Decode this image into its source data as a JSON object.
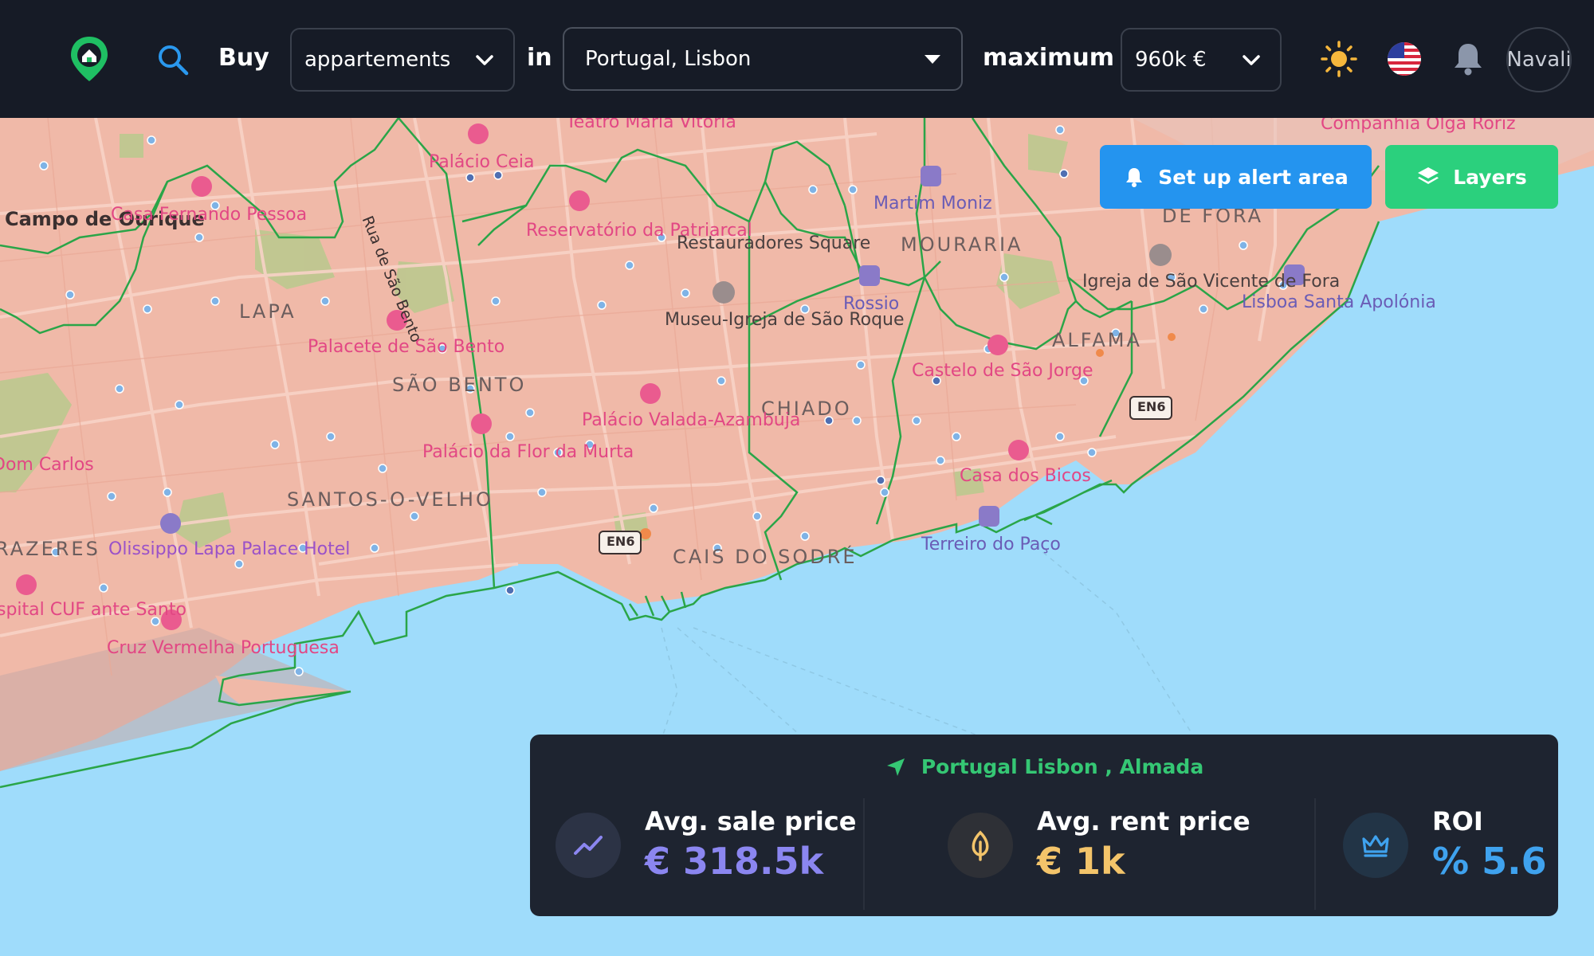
{
  "header": {
    "mode_label": "Buy",
    "property_type": "appartements",
    "in_label": "in",
    "location": "Portugal, Lisbon",
    "max_label": "maximum",
    "max_price": "960k €",
    "user_name": "Navali"
  },
  "map_controls": {
    "alert_button": "Set up alert area",
    "layers_button": "Layers"
  },
  "map_labels": {
    "teatro": "Teatro Maria Vitória",
    "companhia": "Companhia Olga Roriz",
    "campo": "Campo de Ourique",
    "casa_pessoa": "Casa Fernando Pessoa",
    "palacio_ceia": "Palácio Ceia",
    "rua": "Rua de São Bento",
    "reservatorio": "Reservatório da Patriarcal",
    "restauradores": "Restauradores Square",
    "martim": "Martim Moniz",
    "mouraria": "MOURARIA",
    "de_fora": "DE FORA",
    "lapa": "LAPA",
    "palacete": "Palacete de São Bento",
    "museu": "Museu-Igreja de São Roque",
    "rossio": "Rossio",
    "igreja": "Igreja de São Vicente de Fora",
    "lisboa_santa": "Lisboa Santa Apolónia",
    "alfama": "ALFAMA",
    "sao_bento": "SÃO BENTO",
    "castelo": "Castelo de São Jorge",
    "chiado": "CHIADO",
    "palacio_valada": "Palácio Valada-Azambuja",
    "palacio_murta": "Palácio da Flor da Murta",
    "dom_carlos": "Dom Carlos",
    "casa_bicos": "Casa dos Bicos",
    "santos": "SANTOS-O-VELHO",
    "prazeres": "RAZERES",
    "olissippo": "Olissippo Lapa Palace Hotel",
    "en6_a": "EN6",
    "en6_b": "EN6",
    "cais": "CAIS DO SODRÉ",
    "terreiro": "Terreiro do Paço",
    "hospital": "spital CUF ante Santo",
    "cruz": "Cruz Vermelha Portuguesa"
  },
  "summary": {
    "location": "Portugal Lisbon , Almada",
    "sale": {
      "label": "Avg. sale price",
      "value": "€ 318.5k",
      "color": "#8b86f0"
    },
    "rent": {
      "label": "Avg. rent price",
      "value": "€ 1k",
      "color": "#f3c46a"
    },
    "roi": {
      "label": "ROI",
      "value": "% 5.6",
      "color": "#3fa2ee"
    }
  },
  "colors": {
    "topbar": "#161b26",
    "land": "#f0b9a8",
    "water": "#9fdcfb",
    "boundary": "#2aa548",
    "alert_button": "#2494ef",
    "layers_button": "#2bd07d"
  }
}
